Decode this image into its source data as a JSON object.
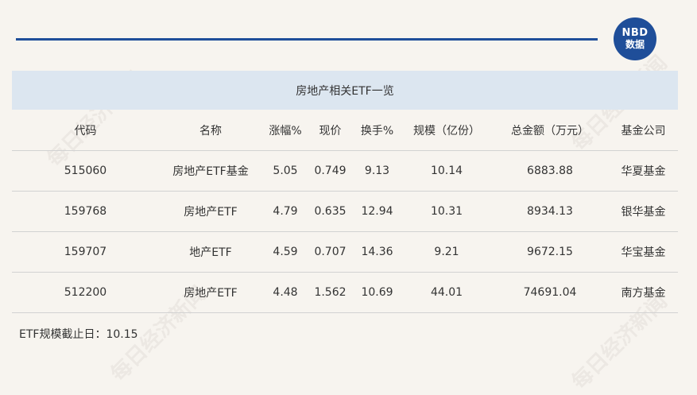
{
  "logo": {
    "line1": "NBD",
    "line2": "数据"
  },
  "title": "房地产相关ETF一览",
  "columns": [
    "代码",
    "名称",
    "涨幅%",
    "现价",
    "换手%",
    "规模（亿份）",
    "总金额（万元）",
    "基金公司"
  ],
  "rows": [
    [
      "515060",
      "房地产ETF基金",
      "5.05",
      "0.749",
      "9.13",
      "10.14",
      "6883.88",
      "华夏基金"
    ],
    [
      "159768",
      "房地产ETF",
      "4.79",
      "0.635",
      "12.94",
      "10.31",
      "8934.13",
      "银华基金"
    ],
    [
      "159707",
      "地产ETF",
      "4.59",
      "0.707",
      "14.36",
      "9.21",
      "9672.15",
      "华宝基金"
    ],
    [
      "512200",
      "房地产ETF",
      "4.48",
      "1.562",
      "10.69",
      "44.01",
      "74691.04",
      "南方基金"
    ]
  ],
  "footnote": "ETF规模截止日：10.15",
  "watermark": "每日经济新闻"
}
